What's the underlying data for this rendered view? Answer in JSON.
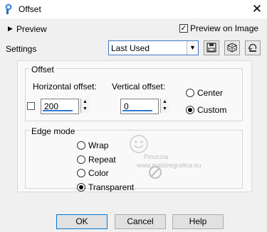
{
  "window": {
    "title": "Offset",
    "close_glyph": "✕"
  },
  "preview": {
    "label": "Preview",
    "preview_on_image_label": "Preview on Image",
    "preview_on_image_checked": true
  },
  "settings": {
    "label": "Settings",
    "selected": "Last Used"
  },
  "offset_group": {
    "title": "Offset",
    "horizontal_label": "Horizontal offset:",
    "horizontal_value": "200",
    "vertical_label": "Vertical offset:",
    "vertical_value": "0",
    "radios": [
      {
        "label": "Center",
        "selected": false
      },
      {
        "label": "Custom",
        "selected": true
      }
    ]
  },
  "edge_mode": {
    "title": "Edge mode",
    "radios": [
      {
        "label": "Wrap",
        "selected": false
      },
      {
        "label": "Repeat",
        "selected": false
      },
      {
        "label": "Color",
        "selected": false
      },
      {
        "label": "Transparent",
        "selected": true
      }
    ]
  },
  "watermark": {
    "line1": "Pinuccia",
    "line2": "www.maldiregrafica.eu"
  },
  "buttons": {
    "ok": "OK",
    "cancel": "Cancel",
    "help": "Help"
  }
}
